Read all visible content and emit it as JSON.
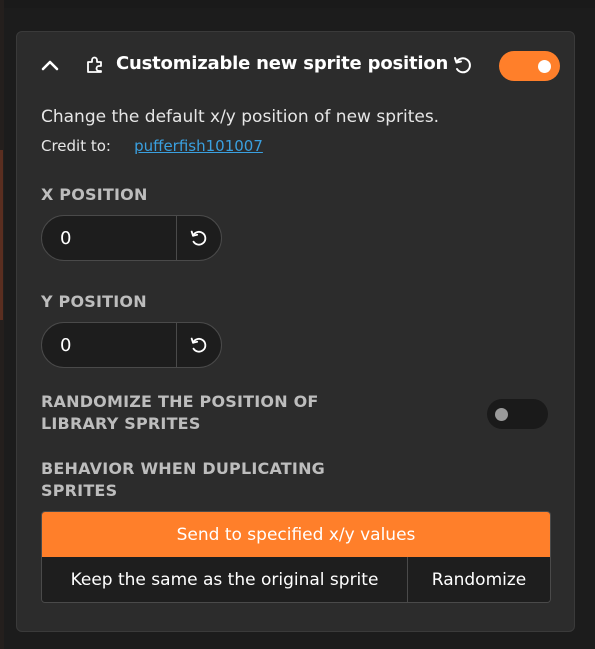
{
  "addon": {
    "title": "Customizable new sprite position",
    "enabled": true,
    "description": "Change the default x/y position of new sprites.",
    "credit_label": "Credit to:",
    "credit_name": "pufferfish101007"
  },
  "settings": {
    "x_position": {
      "label": "X POSITION",
      "value": "0"
    },
    "y_position": {
      "label": "Y POSITION",
      "value": "0"
    },
    "randomize_library": {
      "label_line1": "RANDOMIZE THE POSITION OF",
      "label_line2": "LIBRARY SPRITES",
      "enabled": false
    },
    "duplicate_behavior": {
      "label_line1": "BEHAVIOR WHEN DUPLICATING",
      "label_line2": "SPRITES",
      "options": [
        "Send to specified x/y values",
        "Keep the same as the original sprite",
        "Randomize"
      ],
      "selected": "Send to specified x/y values"
    }
  },
  "colors": {
    "accent": "#ff7f2a",
    "link": "#3aa0e0",
    "card_bg": "#2c2c2c"
  },
  "icons": {
    "collapse": "chevron-up-icon",
    "addon": "puzzle-piece-icon",
    "reset": "reset-icon"
  }
}
